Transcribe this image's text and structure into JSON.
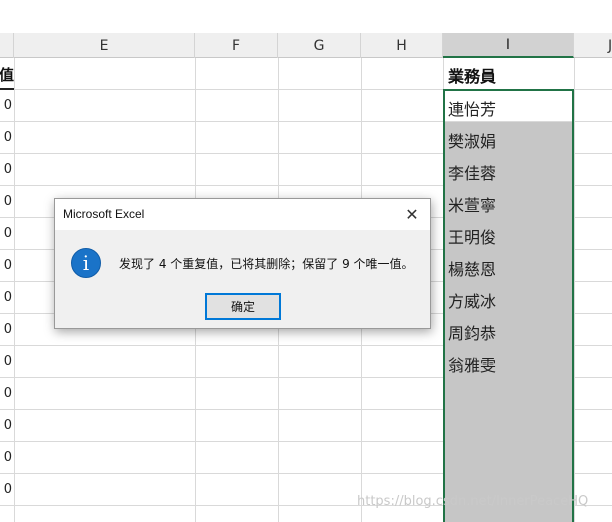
{
  "columns": {
    "E": "E",
    "F": "F",
    "G": "G",
    "H": "H",
    "I": "I",
    "J": "J"
  },
  "left_header_fragment": "值",
  "row_stub_values": [
    "0",
    "0",
    "0",
    "0",
    "0",
    "0",
    "0",
    "0",
    "0",
    "0",
    "0",
    "0",
    "0"
  ],
  "column_I": {
    "header": "業務員",
    "values": [
      "連怡芳",
      "樊淑娟",
      "李佳蓉",
      "米萱寧",
      "王明俊",
      "楊慈恩",
      "方威冰",
      "周鈞恭",
      "翁雅雯"
    ]
  },
  "dialog": {
    "title": "Microsoft Excel",
    "close_glyph": "✕",
    "icon_glyph": "i",
    "message": "发现了 4 个重复值，已将其删除；保留了 9 个唯一值。",
    "ok_label": "确定"
  },
  "watermark": "https://blog.csdn.net/InnerPeaceHQ",
  "colors": {
    "selection_border": "#217346",
    "selection_fill": "#c6c6c6",
    "info_icon": "#1a73c8",
    "ok_button_border": "#0078d7"
  }
}
